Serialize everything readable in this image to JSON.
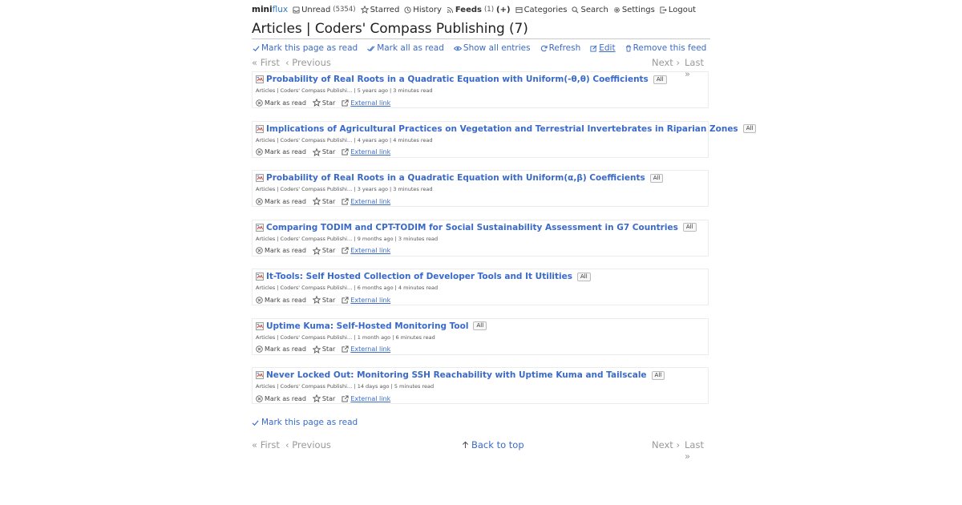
{
  "nav": {
    "logo_mini": "mini",
    "logo_flux": "flux",
    "unread_label": "Unread",
    "unread_count": "(5354)",
    "starred_label": "Starred",
    "history_label": "History",
    "feeds_label": "Feeds",
    "feeds_count": "(1)",
    "feeds_add": "(+)",
    "categories_label": "Categories",
    "search_label": "Search",
    "settings_label": "Settings",
    "logout_label": "Logout"
  },
  "page": {
    "title": "Articles | Coders' Compass Publishing (7)",
    "mark_page_read": "Mark this page as read",
    "mark_all_read": "Mark all as read",
    "show_all": "Show all entries",
    "refresh": "Refresh",
    "edit": "Edit",
    "remove_feed": "Remove this feed"
  },
  "pager": {
    "first": "« First",
    "previous": "‹ Previous",
    "next": "Next ›",
    "last": "Last »"
  },
  "entry_labels": {
    "mark_read": "Mark as read",
    "star": "Star",
    "external": "External link",
    "badge": "All"
  },
  "entries": [
    {
      "title": "Probability of Real Roots in a Quadratic Equation with Uniform(-θ,θ) Coefficients",
      "meta": "Articles | Coders' Compass Publishi… | 5 years ago | 3 minutes read"
    },
    {
      "title": "Implications of Agricultural Practices on Vegetation and Terrestrial Invertebrates in Riparian Zones",
      "meta": "Articles | Coders' Compass Publishi… | 4 years ago | 4 minutes read"
    },
    {
      "title": "Probability of Real Roots in a Quadratic Equation with Uniform(α,β) Coefficients",
      "meta": "Articles | Coders' Compass Publishi… | 3 years ago | 3 minutes read"
    },
    {
      "title": "Comparing TODIM and CPT-TODIM for Social Sustainability Assessment in G7 Countries",
      "meta": "Articles | Coders' Compass Publishi… | 9 months ago | 3 minutes read"
    },
    {
      "title": "It-Tools: Self Hosted Collection of Developer Tools and It Utilities",
      "meta": "Articles | Coders' Compass Publishi… | 6 months ago | 4 minutes read"
    },
    {
      "title": "Uptime Kuma: Self-Hosted Monitoring Tool",
      "meta": "Articles | Coders' Compass Publishi… | 1 month ago | 6 minutes read"
    },
    {
      "title": "Never Locked Out: Monitoring SSH Reachability with Uptime Kuma and Tailscale",
      "meta": "Articles | Coders' Compass Publishi… | 14 days ago | 5 minutes read"
    }
  ],
  "footer": {
    "mark_page_read": "Mark this page as read",
    "back_to_top": "Back to top"
  }
}
